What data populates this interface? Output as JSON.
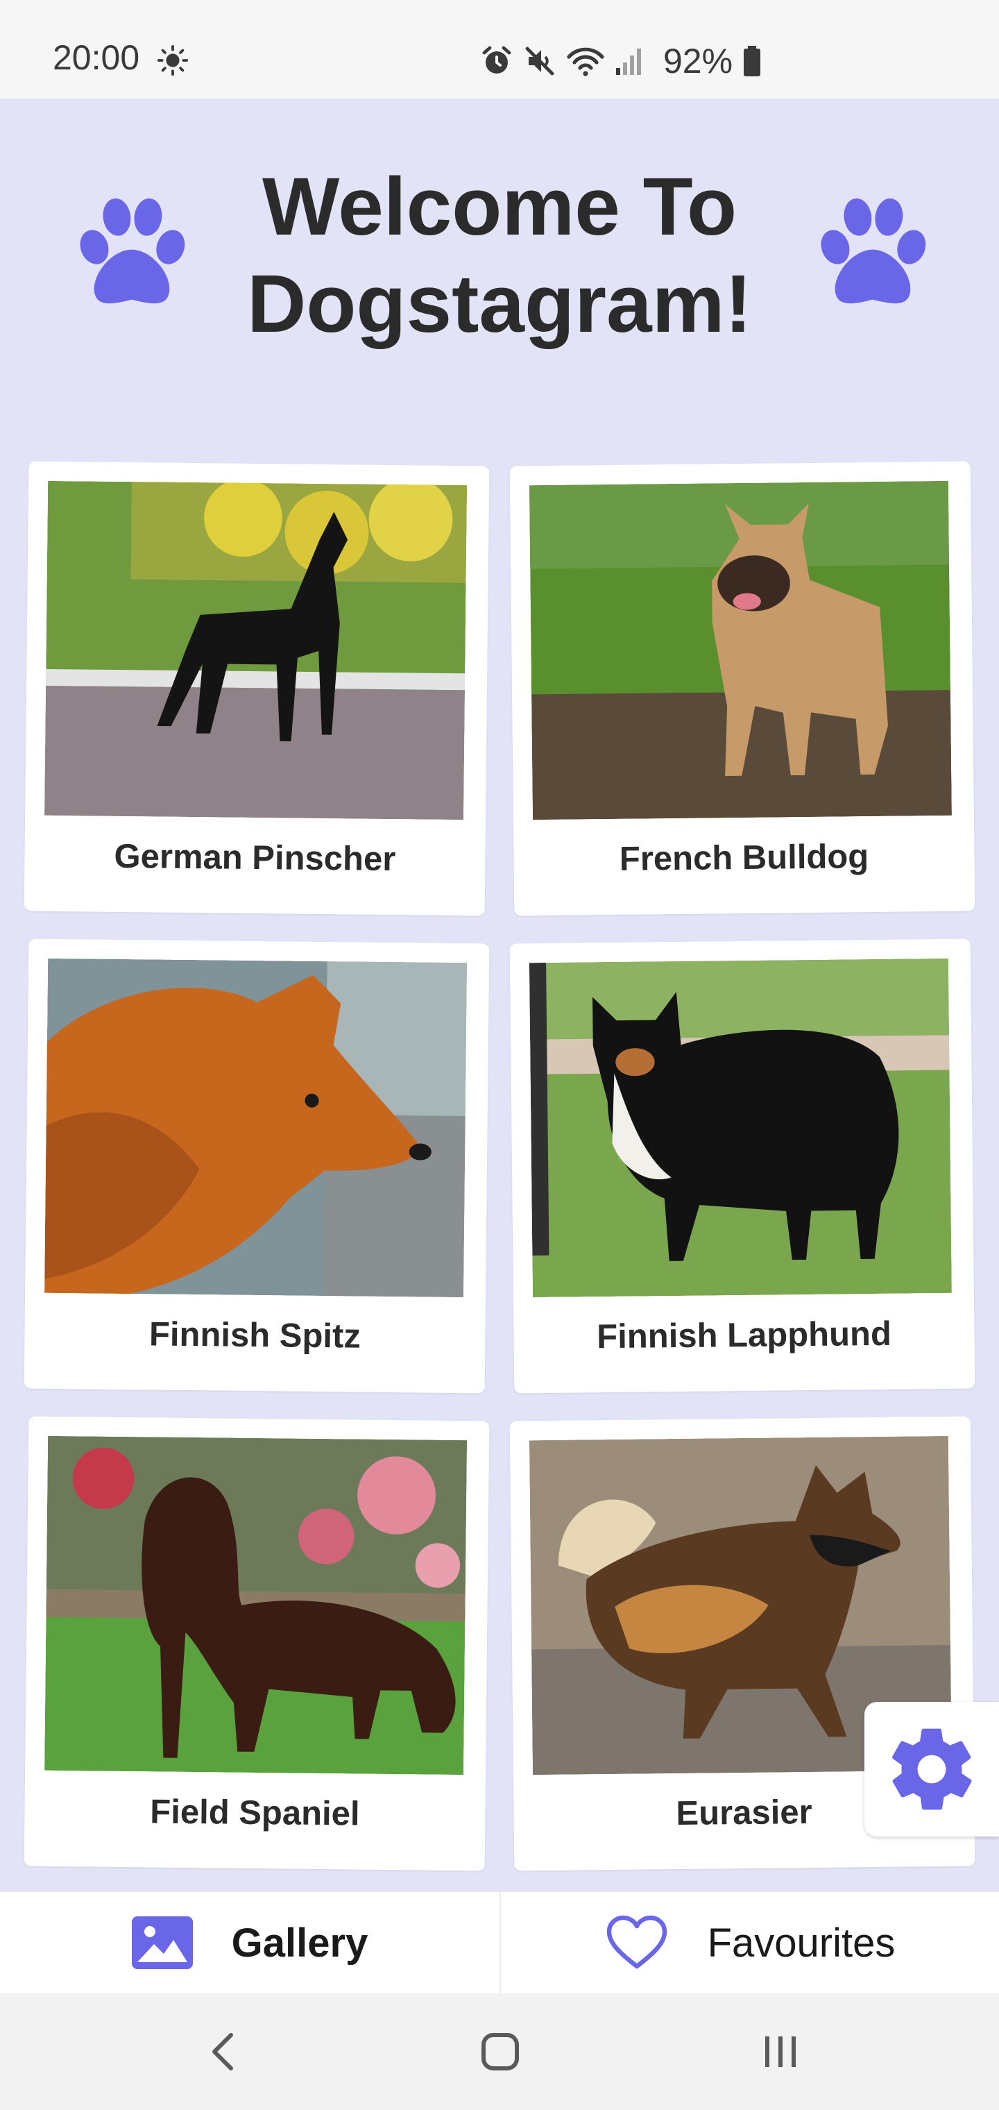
{
  "status_bar": {
    "time": "20:00",
    "battery": "92%",
    "icons": [
      "brightness-icon",
      "alarm-icon",
      "mute-icon",
      "wifi-icon",
      "signal-icon",
      "battery-icon"
    ]
  },
  "header": {
    "title_line1": "Welcome To",
    "title_line2": "Dogstagram!",
    "icons": [
      "paw-icon",
      "paw-icon"
    ]
  },
  "gallery": {
    "breeds": [
      "German Pinscher",
      "French Bulldog",
      "Finnish Spitz",
      "Finnish Lapphund",
      "Field Spaniel",
      "Eurasier"
    ]
  },
  "fab": {
    "icon": "gear-icon"
  },
  "tabs": {
    "gallery_label": "Gallery",
    "favourites_label": "Favourites"
  },
  "colors": {
    "background": "#e3e3f8",
    "accent": "#6a66e8",
    "text": "#2b2b2b"
  },
  "system_nav": {
    "icons": [
      "back-icon",
      "home-icon",
      "recents-icon"
    ]
  }
}
